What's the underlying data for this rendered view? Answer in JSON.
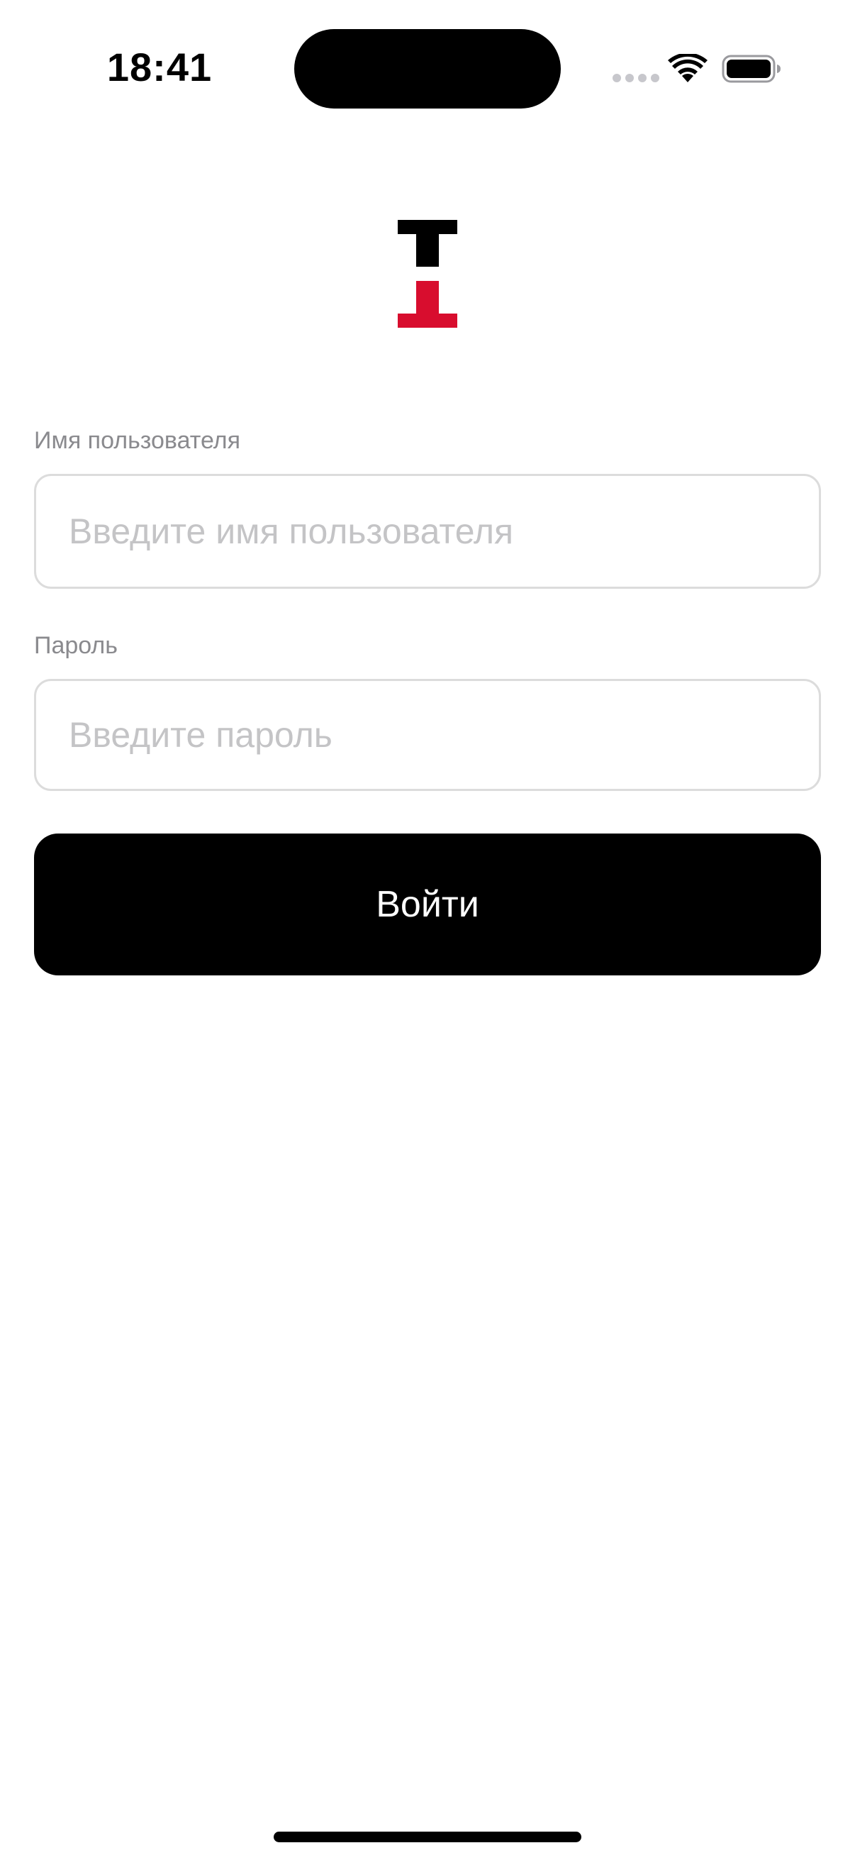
{
  "status_bar": {
    "time": "18:41",
    "icons": [
      "signal-dots-icon",
      "wifi-icon",
      "battery-icon"
    ]
  },
  "logo": {
    "icon": "brand-logo-icon",
    "colors": {
      "top": "#000000",
      "bottom": "#D80D2E"
    }
  },
  "form": {
    "username": {
      "label": "Имя пользователя",
      "placeholder": "Введите имя пользователя",
      "value": ""
    },
    "password": {
      "label": "Пароль",
      "placeholder": "Введите пароль",
      "value": ""
    },
    "submit_label": "Войти"
  },
  "colors": {
    "button_bg": "#000000",
    "button_text": "#FFFFFF",
    "label": "#8A8A8E",
    "placeholder": "#C4C4C6",
    "input_border": "#DCDCDC"
  }
}
